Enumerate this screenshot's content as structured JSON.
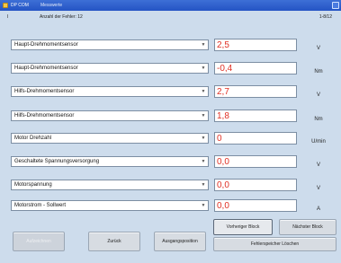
{
  "window": {
    "app_name": "DP COM",
    "window_name": "Messwerte"
  },
  "header": {
    "marker": "I",
    "count_label": "Anzahl der Fehler: 12",
    "page_indicator": "1-8/12"
  },
  "rows": [
    {
      "param": "Haupt-Drehmomentsensor",
      "value": "2,5",
      "unit": "V"
    },
    {
      "param": "Haupt-Drehmomentsensor",
      "value": "-0,4",
      "unit": "Nm"
    },
    {
      "param": "Hilfs-Drehmomentsensor",
      "value": "2,7",
      "unit": "V"
    },
    {
      "param": "Hilfs-Drehmomentsensor",
      "value": "1,8",
      "unit": "Nm"
    },
    {
      "param": "Motor Drehzahl",
      "value": "0",
      "unit": "U/min"
    },
    {
      "param": "Geschaltete Spannungsversorgung",
      "value": "0,0",
      "unit": "V"
    },
    {
      "param": "Motorspannung",
      "value": "0,0",
      "unit": "V"
    },
    {
      "param": "Motorstrom - Sollwert",
      "value": "0,0",
      "unit": "A"
    }
  ],
  "buttons": {
    "aufzeichnen": "Aufzeichnen",
    "zurueck": "Zurück",
    "ausgangsposition": "Ausgangsposition",
    "vorheriger_block": "Vorheriger Block",
    "naechster_block": "Nächster Block",
    "fehlerspeicher_loeschen": "Fehlerspeicher Löschen"
  },
  "colors": {
    "value_text": "#e03024",
    "titlebar": "#2f62cf",
    "background": "#cddcec"
  }
}
